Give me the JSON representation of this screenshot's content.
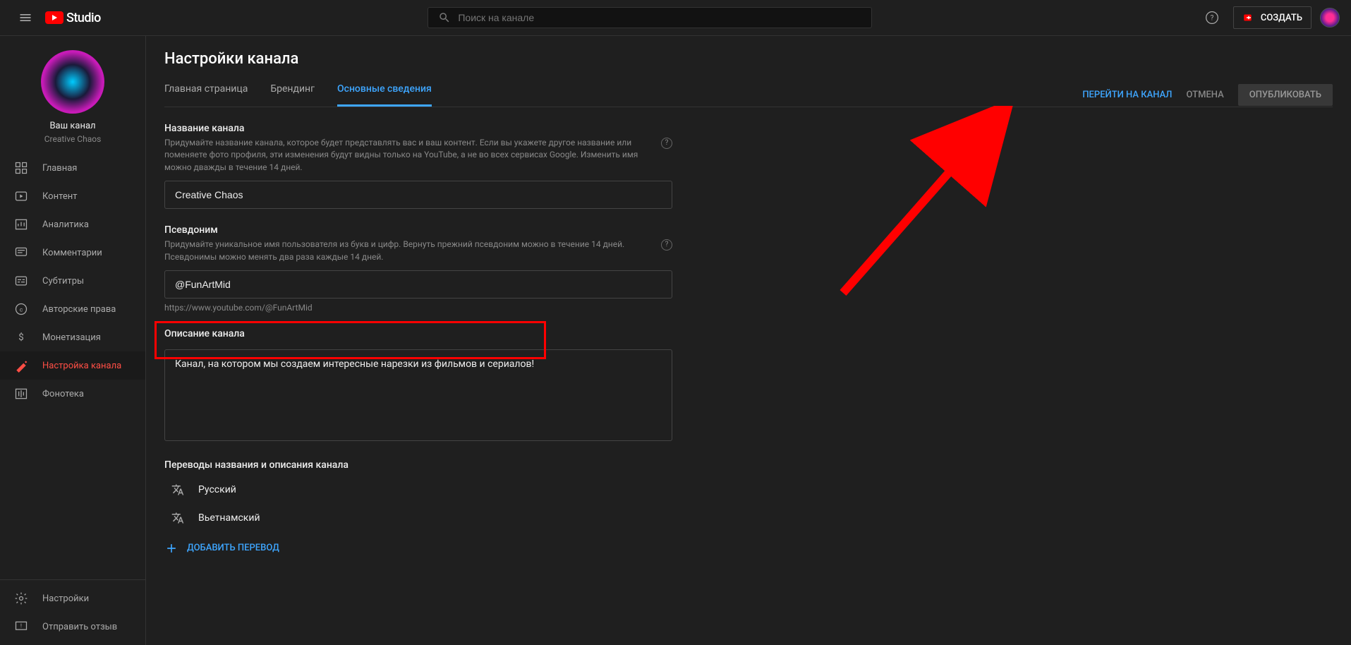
{
  "header": {
    "logo_text": "Studio",
    "search_placeholder": "Поиск на канале",
    "create_label": "СОЗДАТЬ"
  },
  "sidebar": {
    "channel_label": "Ваш канал",
    "channel_name": "Creative Chaos",
    "items": [
      {
        "icon": "dashboard",
        "label": "Главная"
      },
      {
        "icon": "video",
        "label": "Контент"
      },
      {
        "icon": "analytics",
        "label": "Аналитика"
      },
      {
        "icon": "comments",
        "label": "Комментарии"
      },
      {
        "icon": "subtitles",
        "label": "Субтитры"
      },
      {
        "icon": "copyright",
        "label": "Авторские права"
      },
      {
        "icon": "money",
        "label": "Монетизация"
      },
      {
        "icon": "customize",
        "label": "Настройка канала"
      },
      {
        "icon": "audio",
        "label": "Фонотека"
      }
    ],
    "bottom": [
      {
        "icon": "settings",
        "label": "Настройки"
      },
      {
        "icon": "feedback",
        "label": "Отправить отзыв"
      }
    ]
  },
  "main": {
    "title": "Настройки канала",
    "tabs": [
      {
        "label": "Главная страница"
      },
      {
        "label": "Брендинг"
      },
      {
        "label": "Основные сведения",
        "active": true
      }
    ],
    "actions": {
      "view": "ПЕРЕЙТИ НА КАНАЛ",
      "cancel": "ОТМЕНА",
      "publish": "ОПУБЛИКОВАТЬ"
    },
    "name_section": {
      "label": "Название канала",
      "help": "Придумайте название канала, которое будет представлять вас и ваш контент. Если вы укажете другое название или поменяете фото профиля, эти изменения будут видны только на YouTube, а не во всех сервисах Google. Изменить имя можно дважды в течение 14 дней.",
      "value": "Creative Chaos"
    },
    "handle_section": {
      "label": "Псевдоним",
      "help": "Придумайте уникальное имя пользователя из букв и цифр. Вернуть прежний псевдоним можно в течение 14 дней. Псевдонимы можно менять два раза каждые 14 дней.",
      "value": "@FunArtMid",
      "url": "https://www.youtube.com/@FunArtMid"
    },
    "desc_section": {
      "label": "Описание канала",
      "value": "Канал, на котором мы создаем интересные нарезки из фильмов и сериалов!"
    },
    "translations": {
      "label": "Переводы названия и описания канала",
      "langs": [
        "Русский",
        "Вьетнамский"
      ],
      "add": "ДОБАВИТЬ ПЕРЕВОД"
    }
  }
}
